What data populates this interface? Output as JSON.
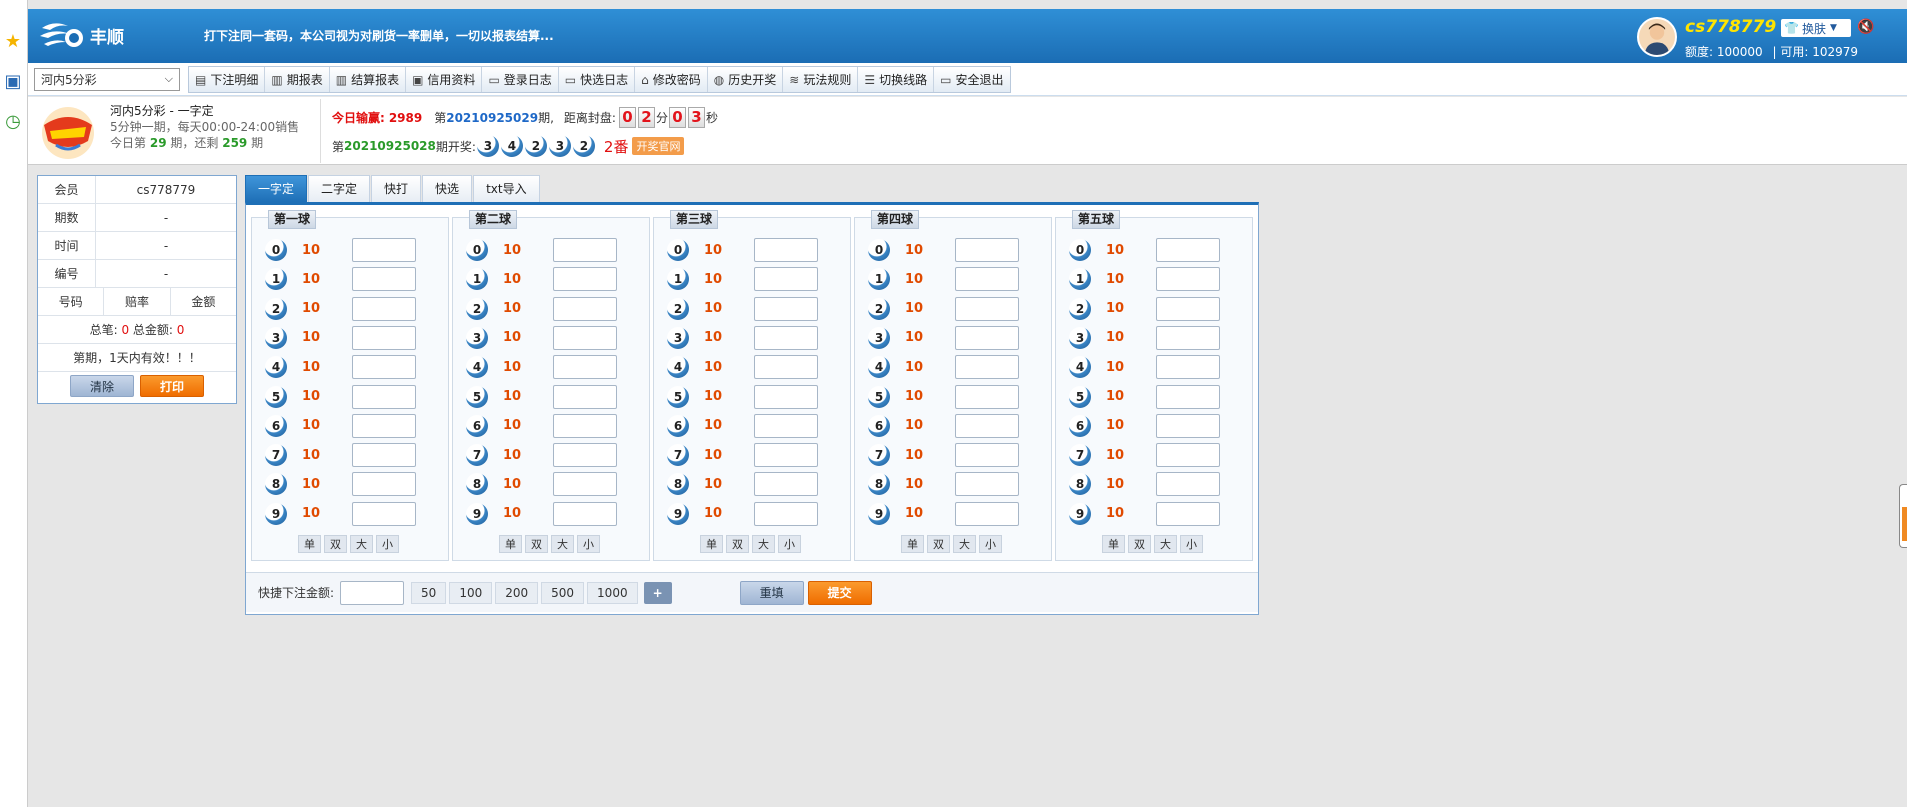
{
  "sidebar": {
    "icons": [
      "star-icon",
      "monitor-icon",
      "clock-icon"
    ]
  },
  "header": {
    "brand": "丰顺",
    "notice": "打下注同一套码，本公司视为对刷货一率删单，一切以报表结算...",
    "username": "cs778779",
    "skin_label": "换肤",
    "quota_label": "额度:",
    "quota_value": "100000",
    "available_label": "| 可用:",
    "available_value": "102979"
  },
  "toolbar": {
    "lottery": "河内5分彩",
    "nav": [
      {
        "label": "下注明细",
        "icon": "▤"
      },
      {
        "label": "期报表",
        "icon": "▥"
      },
      {
        "label": "结算报表",
        "icon": "▥"
      },
      {
        "label": "信用资料",
        "icon": "▣"
      },
      {
        "label": "登录日志",
        "icon": "▭"
      },
      {
        "label": "快选日志",
        "icon": "▭"
      },
      {
        "label": "修改密码",
        "icon": "⌂"
      },
      {
        "label": "历史开奖",
        "icon": "◍"
      },
      {
        "label": "玩法规则",
        "icon": "≋"
      },
      {
        "label": "切换线路",
        "icon": "☰"
      },
      {
        "label": "安全退出",
        "icon": "▭"
      }
    ]
  },
  "info": {
    "game_title": "河内5分彩 - 一字定",
    "game_desc": "5分钟一期，每天00:00-24:00销售",
    "today_prefix": "今日第",
    "today_issue": "29",
    "today_mid": "期，还剩",
    "today_left": "259",
    "today_suffix": "期",
    "today_win_label": "今日输赢:",
    "today_win_value": "2989",
    "issue_prefix": "第",
    "issue_number": "20210925029",
    "issue_suffix": "期,",
    "close_label": "距离封盘:",
    "countdown": [
      "0",
      "2",
      "0",
      "3"
    ],
    "min_label": "分",
    "sec_label": "秒",
    "prev_prefix": "第",
    "prev_issue": "20210925028",
    "prev_suffix": "期开奖:",
    "prev_balls": [
      "3",
      "4",
      "2",
      "3",
      "2"
    ],
    "fan": "2番",
    "official": "开奖官网"
  },
  "ticket": {
    "member_label": "会员",
    "member_value": "cs778779",
    "issue_label": "期数",
    "issue_value": "-",
    "time_label": "时间",
    "time_value": "-",
    "serial_label": "编号",
    "serial_value": "-",
    "h_number": "号码",
    "h_odds": "赔率",
    "h_amount": "金额",
    "total_count_label": "总笔:",
    "total_count": "0",
    "total_amount_label": "总金额:",
    "total_amount": "0",
    "valid_note": "第期，1天内有效！！！",
    "clear": "清除",
    "print": "打印"
  },
  "tabs": [
    "一字定",
    "二字定",
    "快打",
    "快选",
    "txt导入"
  ],
  "columns": [
    {
      "title": "第一球"
    },
    {
      "title": "第二球"
    },
    {
      "title": "第三球"
    },
    {
      "title": "第四球"
    },
    {
      "title": "第五球"
    }
  ],
  "odds": "10",
  "numbers": [
    "0",
    "1",
    "2",
    "3",
    "4",
    "5",
    "6",
    "7",
    "8",
    "9"
  ],
  "quick_picks": [
    "单",
    "双",
    "大",
    "小"
  ],
  "bottom": {
    "quick_label": "快捷下注金额:",
    "amounts": [
      "50",
      "100",
      "200",
      "500",
      "1000"
    ],
    "plus": "+",
    "reset": "重填",
    "submit": "提交"
  }
}
